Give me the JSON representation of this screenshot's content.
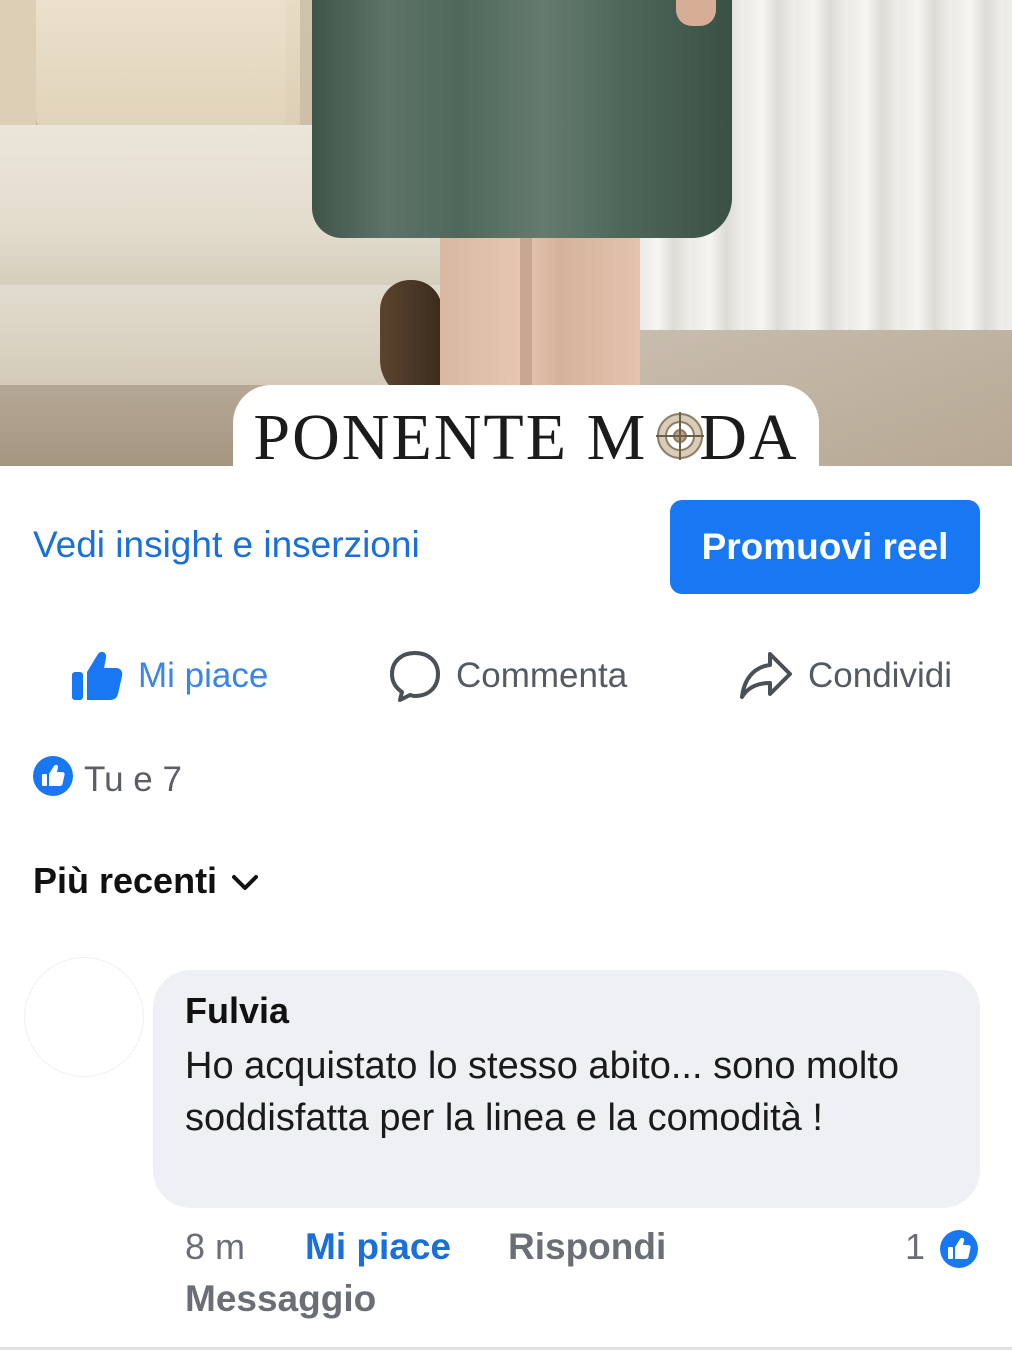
{
  "media": {
    "brand_text": "PONENTE MODA",
    "brand_text_before": "PONENTE M",
    "brand_text_after": "DA"
  },
  "actions": {
    "insight_link": "Vedi insight e inserzioni",
    "promote_button": "Promuovi reel"
  },
  "reactions": {
    "like_label": "Mi piace",
    "comment_label": "Commenta",
    "share_label": "Condividi"
  },
  "likes_summary": "Tu e 7",
  "sort": {
    "label": "Più recenti"
  },
  "comments": [
    {
      "author": "Fulvia",
      "text": "Ho acquistato lo stesso abito... sono molto soddisfatta per la linea e la comodità !",
      "time": "8 m",
      "like_label": "Mi piace",
      "reply_label": "Rispondi",
      "reaction_count": "1",
      "message_label": "Messaggio"
    }
  ],
  "colors": {
    "accent": "#1877f2",
    "link": "#1a6fd8",
    "bubble": "#eef0f3",
    "muted_text": "#6b6f75"
  },
  "icons": {
    "like": "thumbs-up-icon",
    "comment": "speech-bubble-icon",
    "share": "share-arrow-icon",
    "sort": "chevron-down-icon",
    "like_badge": "like-badge-icon"
  }
}
